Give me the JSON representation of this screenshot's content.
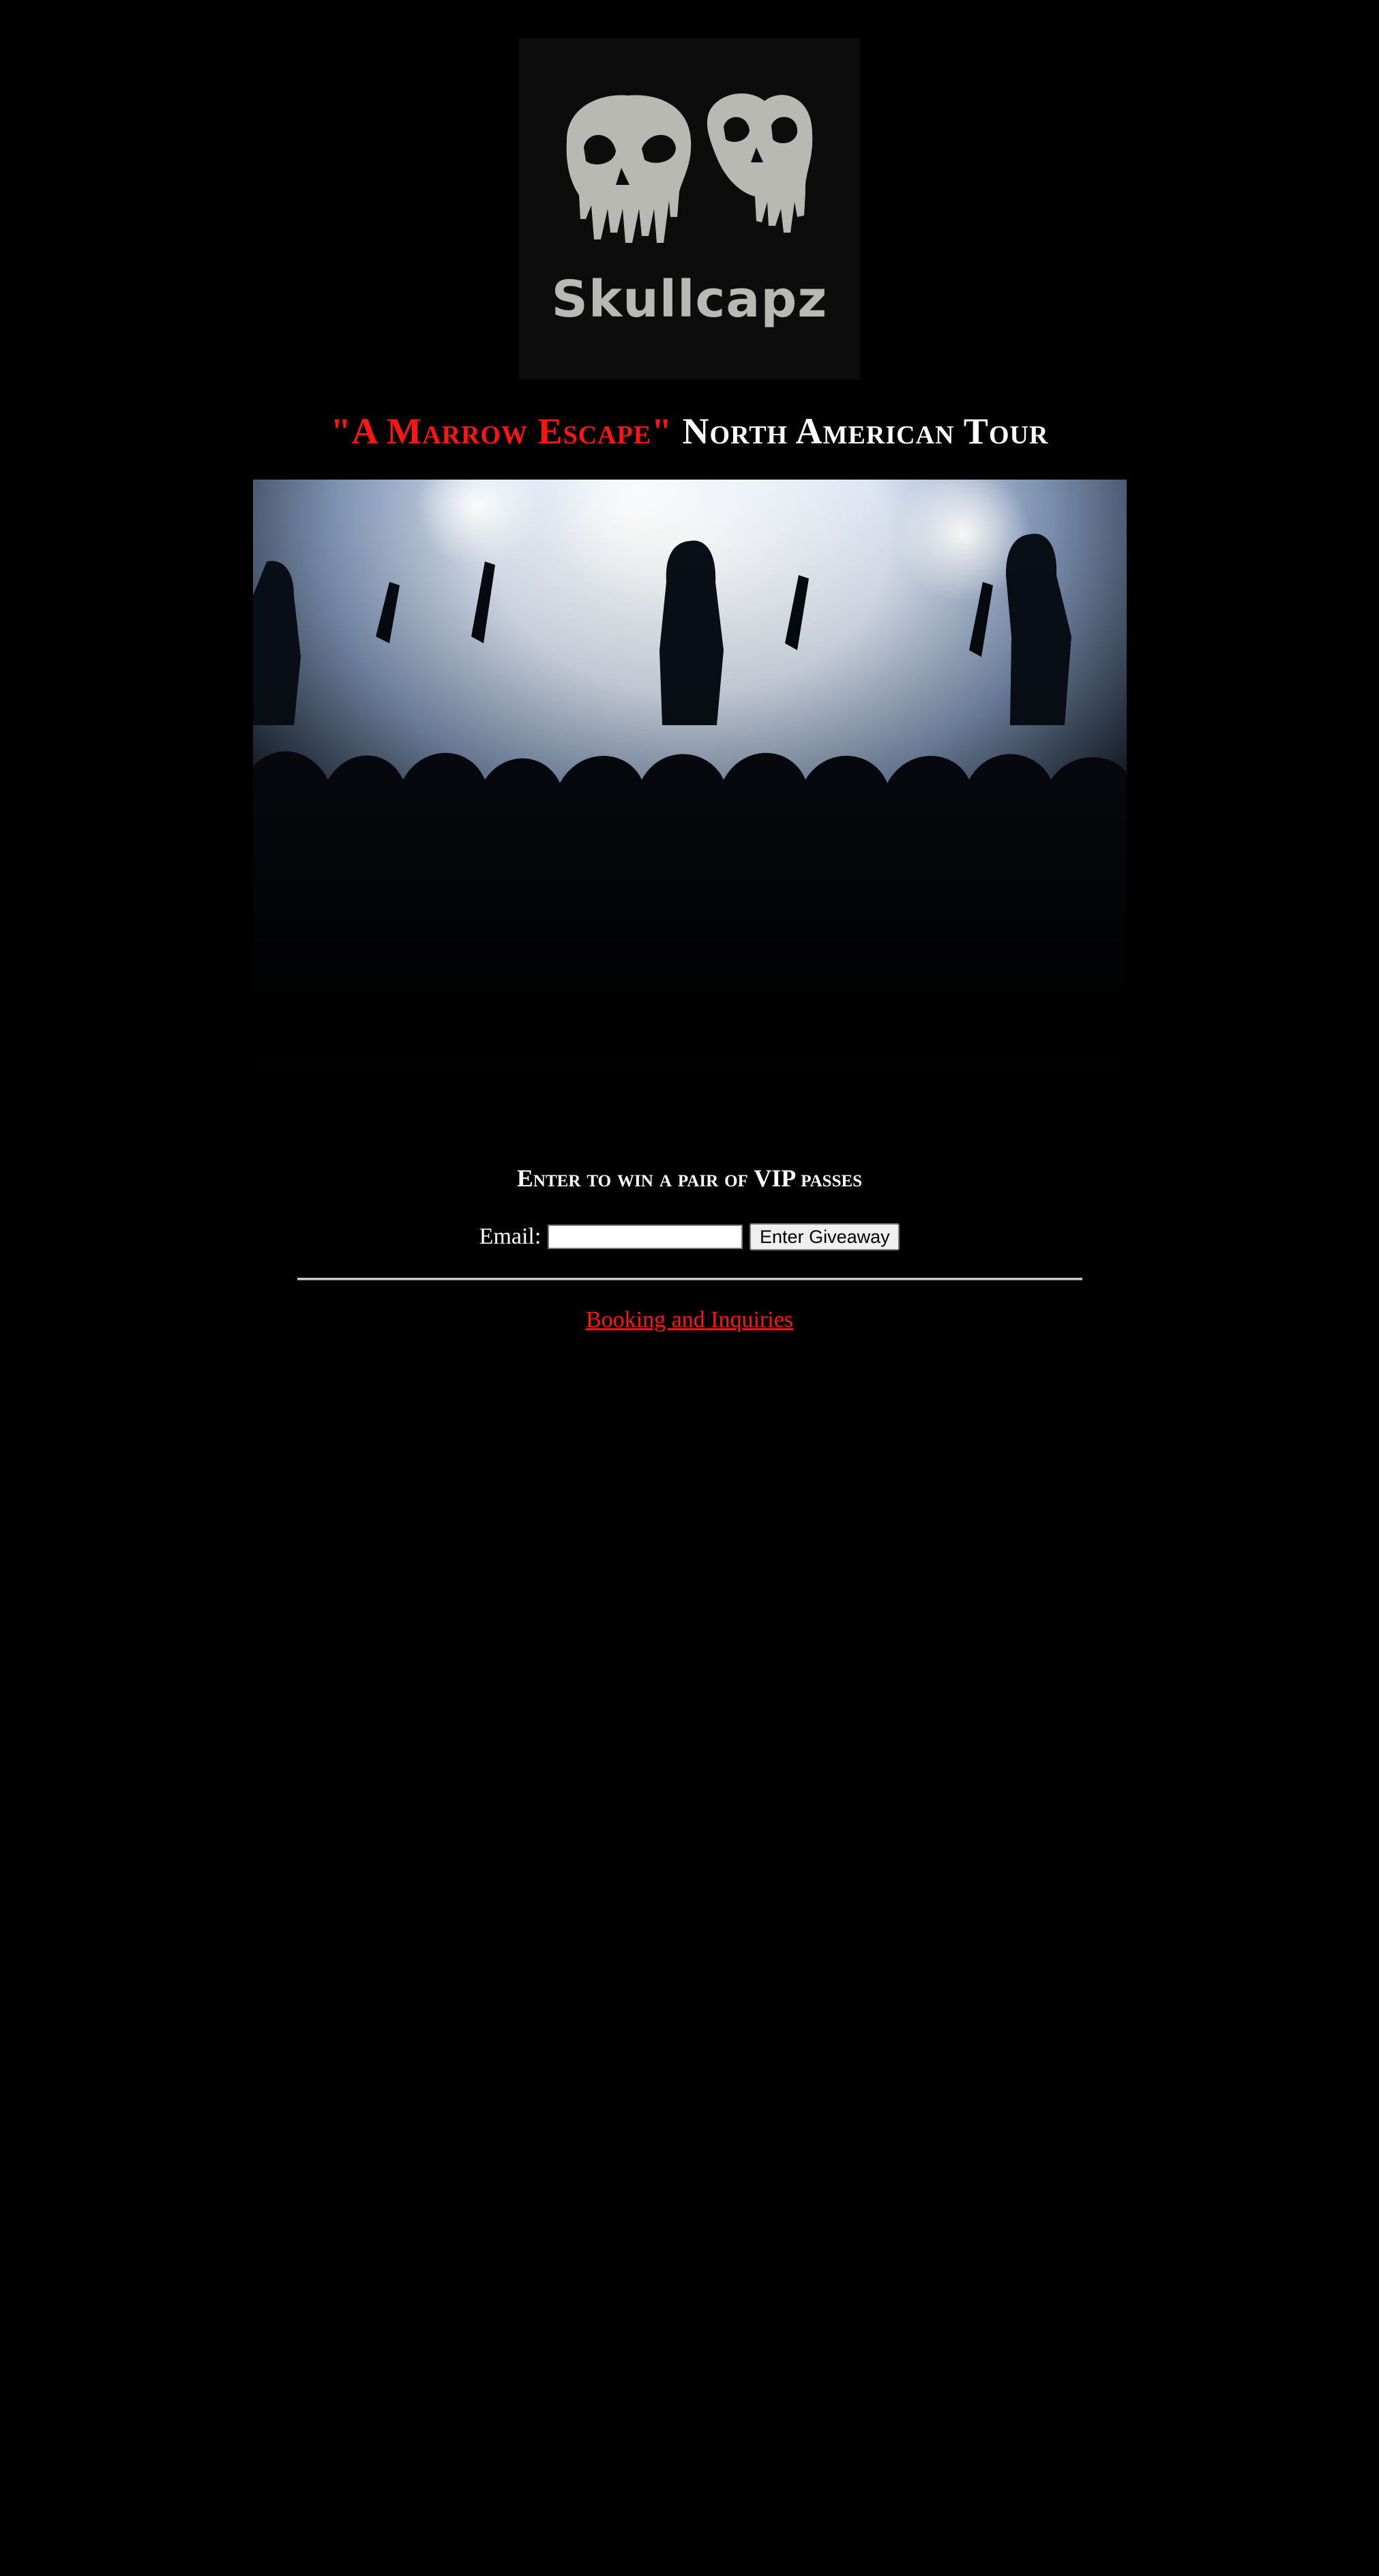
{
  "logo": {
    "wordmark": "Skullcapz",
    "icon": "twin-skulls-logo"
  },
  "tour_heading": {
    "tour_name": "\"A Marrow Escape\"",
    "rest": "North American Tour"
  },
  "hero_image": {
    "description_icon": "concert-crowd-photo"
  },
  "giveaway": {
    "heading": "Enter to win a pair of VIP passes",
    "email_label": "Email:",
    "email_value": "",
    "email_placeholder": "",
    "button_label": "Enter Giveaway"
  },
  "footer": {
    "booking_link": "Booking and Inquiries"
  },
  "colors": {
    "background": "#000000",
    "accent_red": "#ff1414",
    "text": "#ffffff",
    "logo_gray": "#b9b9b3"
  }
}
